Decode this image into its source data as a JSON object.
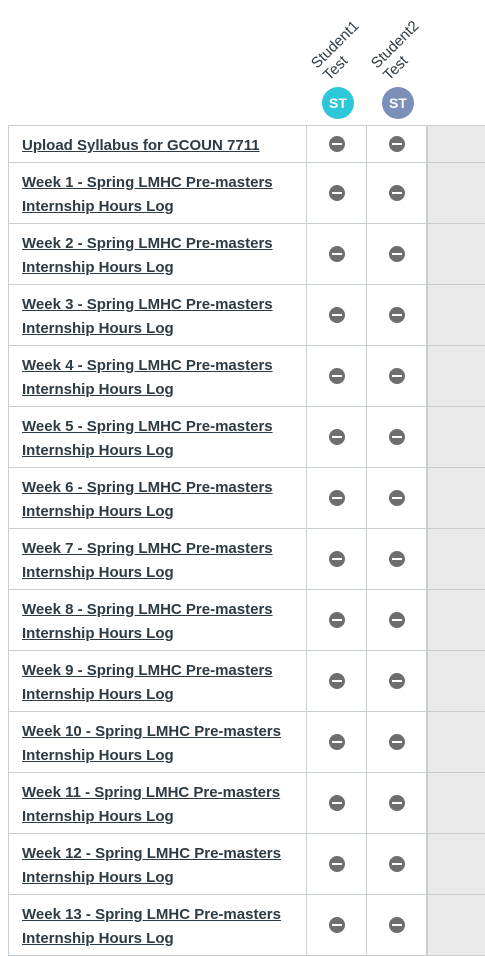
{
  "students": [
    {
      "first": "Student1",
      "last": "Test",
      "initials": "ST",
      "avatar_color": "#2ec7d9"
    },
    {
      "first": "Student2",
      "last": "Test",
      "initials": "ST",
      "avatar_color": "#7b8fb8"
    }
  ],
  "status_icon": "minus-circle-icon",
  "assignments": [
    {
      "title": "Upload Syllabus for GCOUN 7711"
    },
    {
      "title": "Week 1 - Spring LMHC Pre-masters Internship Hours Log"
    },
    {
      "title": "Week 2 - Spring LMHC Pre-masters Internship Hours Log"
    },
    {
      "title": "Week 3 - Spring LMHC Pre-masters Internship Hours Log"
    },
    {
      "title": "Week 4 - Spring LMHC Pre-masters Internship Hours Log"
    },
    {
      "title": "Week 5 - Spring LMHC Pre-masters Internship Hours Log"
    },
    {
      "title": "Week 6 - Spring LMHC Pre-masters Internship Hours Log"
    },
    {
      "title": "Week 7 - Spring LMHC Pre-masters Internship Hours Log"
    },
    {
      "title": "Week 8 - Spring LMHC Pre-masters Internship Hours Log"
    },
    {
      "title": "Week 9 - Spring LMHC Pre-masters Internship Hours Log"
    },
    {
      "title": "Week 10 - Spring LMHC Pre-masters Internship Hours Log"
    },
    {
      "title": "Week 11 - Spring LMHC Pre-masters Internship Hours Log"
    },
    {
      "title": "Week 12 - Spring LMHC Pre-masters Internship Hours Log"
    },
    {
      "title": "Week 13 - Spring LMHC Pre-masters Internship Hours Log"
    }
  ]
}
